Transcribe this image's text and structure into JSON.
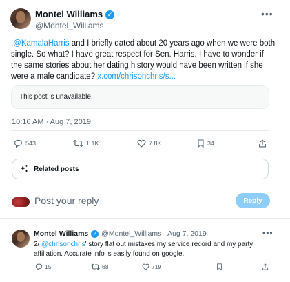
{
  "tweet": {
    "author_name": "Montel Williams",
    "author_handle": "@Montel_Williams",
    "more_icon": "more-horizontal-icon",
    "text_mention": ".@KamalaHarris",
    "text_body": " and I briefly dated about 20 years ago when we were both single. So what? I have great respect for Sen. Harris. I have to wonder if the same stories about her dating history would have been written if she were a male candidate? ",
    "text_link": "x.com/chrisonchris/s...",
    "quote_unavailable": "This post is unavailable.",
    "timestamp": "10:16 AM · Aug 7, 2019",
    "actions": {
      "replies": "543",
      "reposts": "1.1K",
      "likes": "7.8K",
      "bookmarks": "34"
    },
    "related_posts_label": "Related posts"
  },
  "reply_composer": {
    "placeholder": "Post your reply",
    "button_label": "Reply"
  },
  "reply": {
    "author_name": "Montel Williams",
    "handle_and_date": "@Montel_Williams · Aug 7, 2019",
    "text_prefix": "2/ ",
    "text_mention": "@chrisonchris",
    "text_body": "' story flat out mistakes my service record and my party affiliation. Accurate info is easily found on google.",
    "actions": {
      "replies": "15",
      "reposts": "68",
      "likes": "719"
    }
  },
  "colors": {
    "accent": "#1d9bf0",
    "muted_text": "#536471",
    "reply_button_disabled": "#8ecdf8"
  }
}
